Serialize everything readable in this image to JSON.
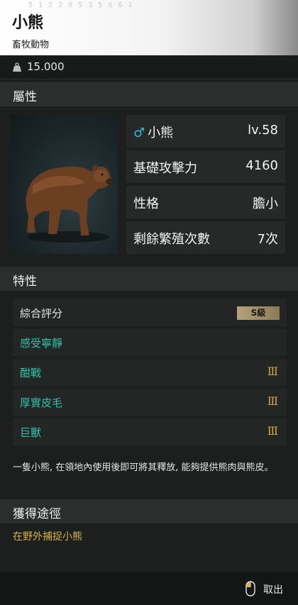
{
  "header": {
    "faint_text": "5 1 2 2 0 5 3 5 6 6 1",
    "title": "小熊",
    "subtitle": "畜牧動物"
  },
  "weight": {
    "icon": "weight-icon",
    "value": "15.000"
  },
  "attributes": {
    "heading": "屬性",
    "portrait": "bear-image",
    "name_symbol": "♂",
    "name": "小熊",
    "level": "lv.58",
    "attack_label": "基礎攻擊力",
    "attack_value": "4160",
    "personality_label": "性格",
    "personality_value": "膽小",
    "breeding_label": "剩餘繁殖次數",
    "breeding_value": "7次"
  },
  "traits": {
    "heading": "特性",
    "rating_label": "綜合評分",
    "rating_value": "S級",
    "items": [
      {
        "label": "感受寧靜",
        "level": ""
      },
      {
        "label": "酣戰",
        "level": "Ⅲ"
      },
      {
        "label": "厚實皮毛",
        "level": "Ⅲ"
      },
      {
        "label": "巨獸",
        "level": "Ⅲ"
      }
    ]
  },
  "description": "一隻小熊, 在領地內使用後即可將其釋放, 能夠提供熊肉與熊皮。",
  "obtain": {
    "heading": "獲得途徑",
    "source": "在野外捕捉小熊"
  },
  "footer": {
    "icon": "mouse-icon",
    "label": "取出"
  },
  "colors": {
    "teal": "#2ec2a6",
    "gold": "#c9a542",
    "male": "#2fb9d8"
  }
}
